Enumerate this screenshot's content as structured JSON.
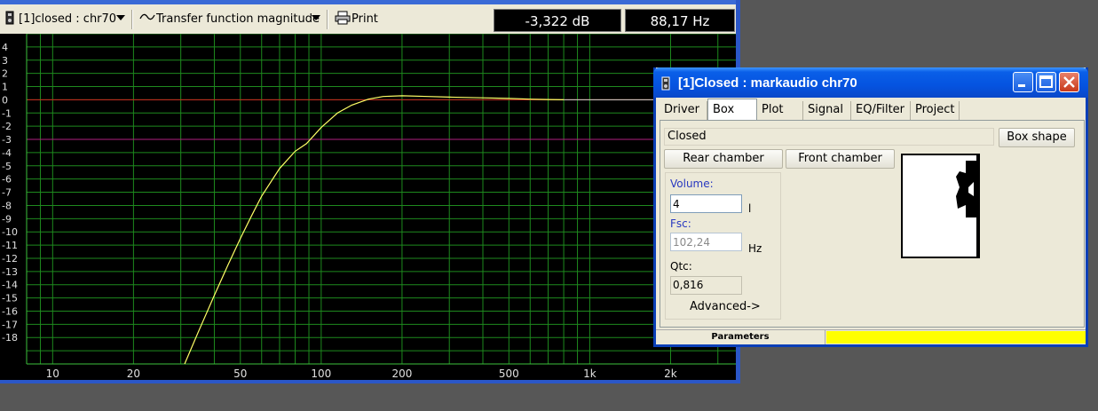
{
  "toolbar": {
    "project_label": "[1]closed : chr70",
    "view_label": "Transfer function magnitude",
    "print_label": "Print",
    "readout_db": "-3,322 dB",
    "readout_hz": "88,17 Hz"
  },
  "dialog": {
    "title": "[1]Closed : markaudio chr70",
    "tabs": [
      {
        "label": "Driver"
      },
      {
        "label": "Box"
      },
      {
        "label": "Plot"
      },
      {
        "label": "Signal"
      },
      {
        "label": "EQ/Filter"
      },
      {
        "label": "Project"
      }
    ],
    "active_tab": "Box",
    "box_type": "Closed",
    "box_shape_button": "Box shape",
    "rear_chamber_button": "Rear chamber",
    "front_chamber_button": "Front chamber",
    "volume_label": "Volume:",
    "volume_value": "4",
    "volume_unit": "l",
    "fsc_label": "Fsc:",
    "fsc_value": "102,24",
    "fsc_unit": "Hz",
    "qtc_label": "Qtc:",
    "qtc_value": "0,816",
    "advanced_button": "Advanced->",
    "status_label": "Parameters"
  },
  "colors": {
    "grid": "#1e8a1e",
    "curve": "#ffff66",
    "zero_line": "#d02020",
    "minus3_line": "#b02080",
    "dialog_title": "#0553e0",
    "status_fill": "#ffff00"
  },
  "chart_data": {
    "type": "line",
    "x_scale": "log",
    "xlim": [
      8,
      3500
    ],
    "ylim": [
      -20,
      5
    ],
    "x_ticks": [
      10,
      20,
      50,
      100,
      200,
      500,
      1000,
      2000
    ],
    "x_tick_labels": [
      "10",
      "20",
      "50",
      "100",
      "200",
      "500",
      "1k",
      "2k"
    ],
    "y_ticks": [
      4,
      3,
      2,
      1,
      0,
      -1,
      -2,
      -3,
      -4,
      -5,
      -6,
      -7,
      -8,
      -9,
      -10,
      -11,
      -12,
      -13,
      -14,
      -15,
      -16,
      -17,
      -18
    ],
    "reference_lines": [
      0,
      -3
    ],
    "series": [
      {
        "x": [
          31,
          35,
          40,
          45,
          50,
          55,
          60,
          70,
          80,
          88.17,
          100,
          115,
          130,
          150,
          170,
          200,
          250,
          300,
          400,
          500,
          600,
          700,
          800
        ],
        "y": [
          -20,
          -17.5,
          -14.8,
          -12.5,
          -10.5,
          -8.8,
          -7.3,
          -5.2,
          -3.9,
          -3.32,
          -2.1,
          -1.0,
          -0.4,
          0.05,
          0.25,
          0.3,
          0.25,
          0.2,
          0.15,
          0.1,
          0.05,
          0.02,
          0.0
        ]
      }
    ]
  }
}
